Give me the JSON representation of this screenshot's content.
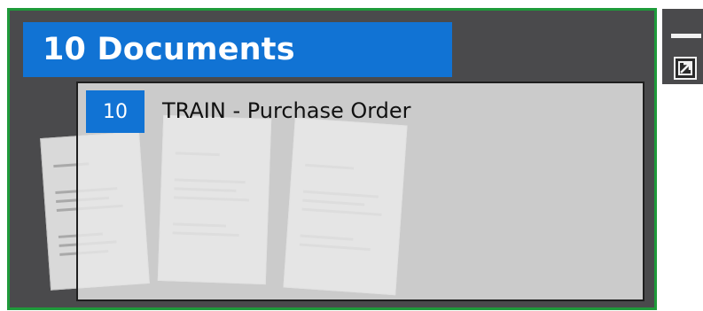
{
  "tile": {
    "header_title": "10 Documents",
    "accent_color": "#1173d4",
    "border_color": "#1e9a3a"
  },
  "card": {
    "count": "10",
    "title": "TRAIN - Purchase Order"
  },
  "toolbar": {
    "minimize_icon": "minimize-icon",
    "expand_icon": "expand-icon"
  }
}
